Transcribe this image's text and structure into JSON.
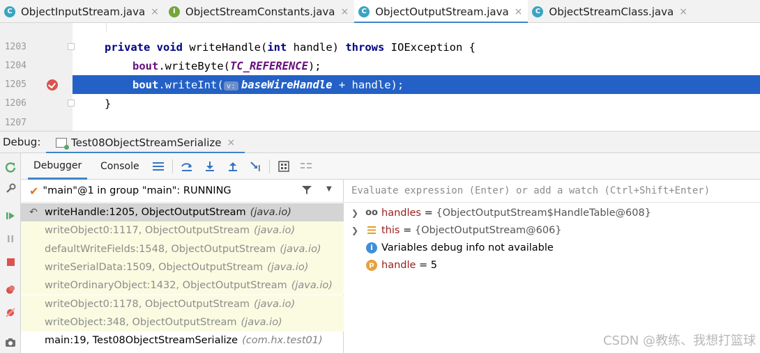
{
  "tabs": [
    {
      "icon": "C",
      "label": "ObjectInputStream.java",
      "close": "×"
    },
    {
      "icon": "I",
      "label": "ObjectStreamConstants.java",
      "close": "×"
    },
    {
      "icon": "C",
      "label": "ObjectOutputStream.java",
      "close": "×"
    },
    {
      "icon": "C",
      "label": "ObjectStreamClass.java",
      "close": "×"
    }
  ],
  "editor": {
    "lines": [
      {
        "num": "1203"
      },
      {
        "num": "1204"
      },
      {
        "num": "1205"
      },
      {
        "num": "1206"
      },
      {
        "num": "1207"
      }
    ],
    "code": {
      "l1_kw1": "private",
      "l1_kw2": "void",
      "l1_mid1": " writeHandle(",
      "l1_kw3": "int",
      "l1_mid2": " handle) ",
      "l1_kw4": "throws",
      "l1_end": " IOException {",
      "l2_fld": "bout",
      "l2_mid": ".writeByte(",
      "l2_const": "TC_REFERENCE",
      "l2_end": ");",
      "l3_fld": "bout",
      "l3_mid": ".writeInt(",
      "l3_hint": "v:",
      "l3_const": "baseWireHandle",
      "l3_end": " + handle);",
      "l4": "}"
    }
  },
  "debug": {
    "label": "Debug:",
    "session": "Test08ObjectStreamSerialize",
    "session_close": "×"
  },
  "toolbar": {
    "tab_debugger": "Debugger",
    "tab_console": "Console"
  },
  "thread": {
    "label": "\"main\"@1 in group \"main\": RUNNING"
  },
  "frames": [
    {
      "method": "writeHandle:1205, ObjectOutputStream",
      "pkg": "(java.io)"
    },
    {
      "method": "writeObject0:1117, ObjectOutputStream",
      "pkg": "(java.io)"
    },
    {
      "method": "defaultWriteFields:1548, ObjectOutputStream",
      "pkg": "(java.io)"
    },
    {
      "method": "writeSerialData:1509, ObjectOutputStream",
      "pkg": "(java.io)"
    },
    {
      "method": "writeOrdinaryObject:1432, ObjectOutputStream",
      "pkg": "(java.io)"
    },
    {
      "method": "writeObject0:1178, ObjectOutputStream",
      "pkg": "(java.io)"
    },
    {
      "method": "writeObject:348, ObjectOutputStream",
      "pkg": "(java.io)"
    },
    {
      "method": "main:19, Test08ObjectStreamSerialize",
      "pkg": "(com.hx.test01)"
    }
  ],
  "evaluate": {
    "placeholder": "Evaluate expression (Enter) or add a watch (Ctrl+Shift+Enter)"
  },
  "variables": [
    {
      "name": "handles",
      "eq": " = ",
      "value": "{ObjectOutputStream$HandleTable@608}"
    },
    {
      "name": "this",
      "eq": " = ",
      "value": "{ObjectOutputStream@606}"
    },
    {
      "name": "Variables debug info not available"
    },
    {
      "name": "handle",
      "eq": " = ",
      "value": "5"
    }
  ],
  "icons": {
    "watch": "oo",
    "info": "i",
    "param": "p"
  },
  "watermark": "CSDN @教练、我想打篮球",
  "colors": {
    "selection": "#2461c6",
    "accent": "#4083c9",
    "library_frame_bg": "#fafbe1",
    "breakpoint": "#d9534f"
  }
}
